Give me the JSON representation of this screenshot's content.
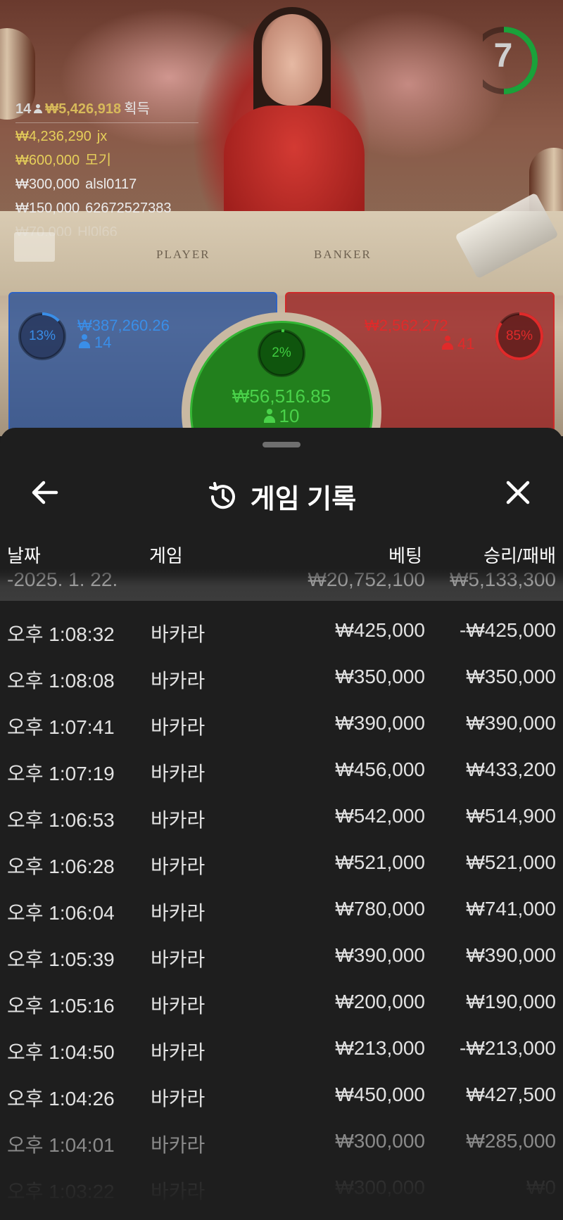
{
  "live": {
    "timer": "7",
    "winners": {
      "count": "14",
      "total": "₩5,426,918",
      "label": "획득",
      "rows": [
        {
          "amount": "₩4,236,290",
          "name": "jx",
          "style": "gold"
        },
        {
          "amount": "₩600,000",
          "name": "모기",
          "style": "gold"
        },
        {
          "amount": "₩300,000",
          "name": "alsl0117",
          "style": "white"
        },
        {
          "amount": "₩150,000",
          "name": "62672527383",
          "style": "white"
        },
        {
          "amount": "₩70,000",
          "name": "Hl0l66",
          "style": "fade"
        }
      ]
    },
    "table_labels": {
      "player": "PLAYER",
      "banker": "BANKER"
    },
    "player": {
      "percent": "13%",
      "amount": "₩387,260.26",
      "count": "14",
      "percent_value": 13
    },
    "banker": {
      "percent": "85%",
      "amount": "₩2,562,272",
      "count": "41",
      "percent_value": 85
    },
    "tie": {
      "percent": "2%",
      "amount": "₩56,516.85",
      "count": "10",
      "percent_value": 2
    },
    "colors": {
      "player": "#2f63c4",
      "banker": "#cf2a2a",
      "tie": "#34b534",
      "gold": "#e6cf5a"
    }
  },
  "sheet": {
    "title": "게임 기록",
    "icons": {
      "back": "arrow-left-icon",
      "history": "history-icon",
      "close": "close-icon"
    },
    "columns": {
      "date": "날짜",
      "game": "게임",
      "bet": "베팅",
      "result": "승리/패배"
    },
    "date_row": {
      "date": "-2025. 1. 22.",
      "bet": "₩20,752,100",
      "result": "₩5,133,300"
    },
    "rows": [
      {
        "time": "오후 1:08:32",
        "game": "바카라",
        "bet": "₩425,000",
        "result": "-₩425,000"
      },
      {
        "time": "오후 1:08:08",
        "game": "바카라",
        "bet": "₩350,000",
        "result": "₩350,000"
      },
      {
        "time": "오후 1:07:41",
        "game": "바카라",
        "bet": "₩390,000",
        "result": "₩390,000"
      },
      {
        "time": "오후 1:07:19",
        "game": "바카라",
        "bet": "₩456,000",
        "result": "₩433,200"
      },
      {
        "time": "오후 1:06:53",
        "game": "바카라",
        "bet": "₩542,000",
        "result": "₩514,900"
      },
      {
        "time": "오후 1:06:28",
        "game": "바카라",
        "bet": "₩521,000",
        "result": "₩521,000"
      },
      {
        "time": "오후 1:06:04",
        "game": "바카라",
        "bet": "₩780,000",
        "result": "₩741,000"
      },
      {
        "time": "오후 1:05:39",
        "game": "바카라",
        "bet": "₩390,000",
        "result": "₩390,000"
      },
      {
        "time": "오후 1:05:16",
        "game": "바카라",
        "bet": "₩200,000",
        "result": "₩190,000"
      },
      {
        "time": "오후 1:04:50",
        "game": "바카라",
        "bet": "₩213,000",
        "result": "-₩213,000"
      },
      {
        "time": "오후 1:04:26",
        "game": "바카라",
        "bet": "₩450,000",
        "result": "₩427,500"
      },
      {
        "time": "오후 1:04:01",
        "game": "바카라",
        "bet": "₩300,000",
        "result": "₩285,000"
      },
      {
        "time": "오후 1:03:22",
        "game": "바카라",
        "bet": "₩300,000",
        "result": "₩0"
      }
    ]
  }
}
